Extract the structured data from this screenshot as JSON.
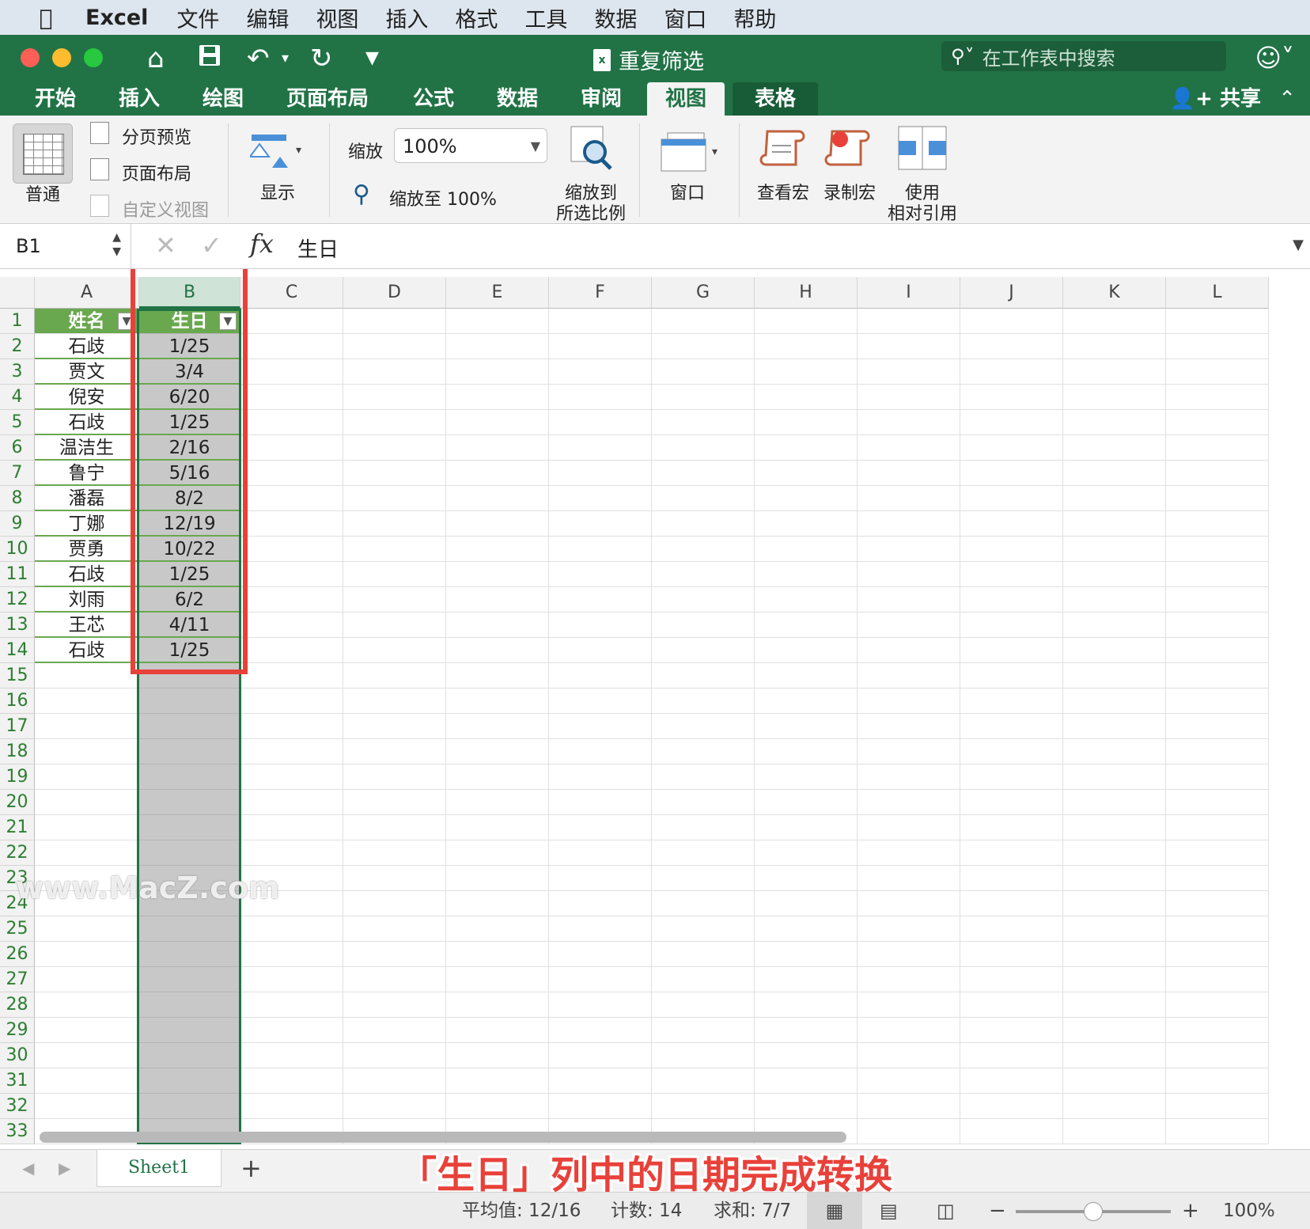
{
  "menubar": {
    "app": "Excel",
    "items": [
      "文件",
      "编辑",
      "视图",
      "插入",
      "格式",
      "工具",
      "数据",
      "窗口",
      "帮助"
    ]
  },
  "titlebar": {
    "title": "重复筛选",
    "search_placeholder": "在工作表中搜索"
  },
  "tabs": [
    "开始",
    "插入",
    "绘图",
    "页面布局",
    "公式",
    "数据",
    "审阅",
    "视图",
    "表格"
  ],
  "active_tab": "视图",
  "share": "共享",
  "ribbon": {
    "normal": "普通",
    "page_break": "分页预览",
    "page_layout": "页面布局",
    "custom_view": "自定义视图",
    "show": "显示",
    "zoom_label": "缩放",
    "zoom_value": "100%",
    "zoom_100": "缩放至 100%",
    "zoom_sel_1": "缩放到",
    "zoom_sel_2": "所选比例",
    "window": "窗口",
    "view_macro": "查看宏",
    "record_macro": "录制宏",
    "relative_1": "使用",
    "relative_2": "相对引用"
  },
  "formula_bar": {
    "name_box": "B1",
    "fx": "fx",
    "value": "生日"
  },
  "columns": [
    "A",
    "B",
    "C",
    "D",
    "E",
    "F",
    "G",
    "H",
    "I",
    "J",
    "K",
    "L"
  ],
  "rows": [
    [
      "姓名",
      "生日"
    ],
    [
      "石歧",
      "1/25"
    ],
    [
      "贾文",
      "3/4"
    ],
    [
      "倪安",
      "6/20"
    ],
    [
      "石歧",
      "1/25"
    ],
    [
      "温洁生",
      "2/16"
    ],
    [
      "鲁宁",
      "5/16"
    ],
    [
      "潘磊",
      "8/2"
    ],
    [
      "丁娜",
      "12/19"
    ],
    [
      "贾勇",
      "10/22"
    ],
    [
      "石歧",
      "1/25"
    ],
    [
      "刘雨",
      "6/2"
    ],
    [
      "王芯",
      "4/11"
    ],
    [
      "石歧",
      "1/25"
    ]
  ],
  "row_count": 33,
  "sheet_tab": "Sheet1",
  "caption": "「生日」列中的日期完成转换",
  "watermark": "www.MacZ.com",
  "status": {
    "average": "平均值: 12/16",
    "count": "计数: 14",
    "sum": "求和: 7/7",
    "zoom": "100%"
  },
  "colors": {
    "excel_green": "#217346",
    "highlight_red": "#e8413a",
    "header_green": "#6aa84f"
  }
}
